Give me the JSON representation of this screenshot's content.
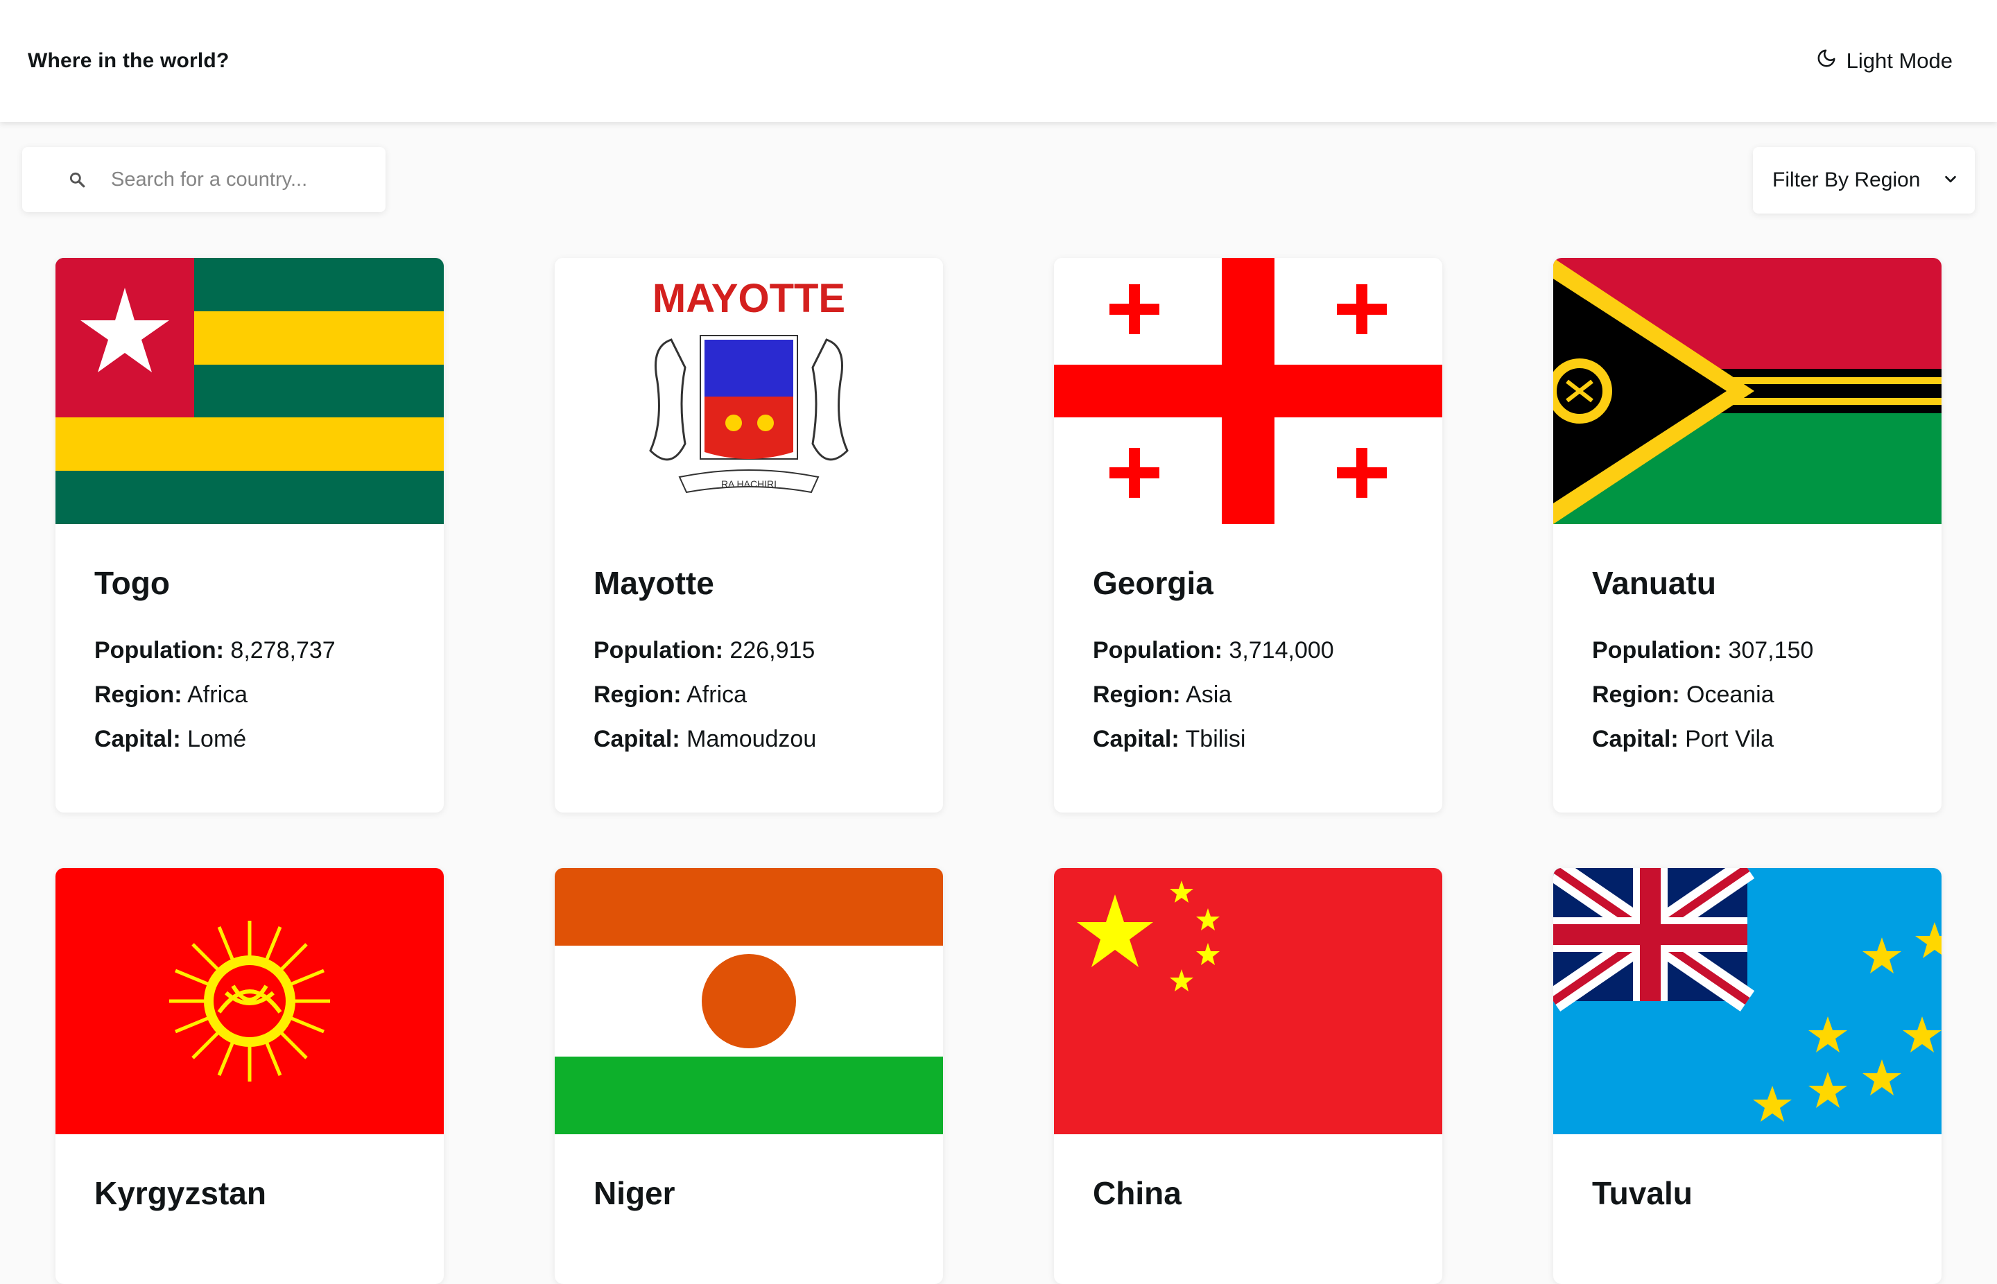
{
  "header": {
    "title": "Where in the world?",
    "mode_label": "Light Mode",
    "mode_icon": "moon-icon"
  },
  "search": {
    "placeholder": "Search for a country...",
    "icon": "search-icon"
  },
  "filter": {
    "label": "Filter By Region",
    "icon": "chevron-down-icon"
  },
  "labels": {
    "population": "Population:",
    "region": "Region:",
    "capital": "Capital:"
  },
  "flag_text": {
    "mayotte_banner": "MAYOTTE",
    "mayotte_ribbon": "RA HACHIRI"
  },
  "countries": [
    {
      "name": "Togo",
      "population": "8,278,737",
      "region": "Africa",
      "capital": "Lomé"
    },
    {
      "name": "Mayotte",
      "population": "226,915",
      "region": "Africa",
      "capital": "Mamoudzou"
    },
    {
      "name": "Georgia",
      "population": "3,714,000",
      "region": "Asia",
      "capital": "Tbilisi"
    },
    {
      "name": "Vanuatu",
      "population": "307,150",
      "region": "Oceania",
      "capital": "Port Vila"
    },
    {
      "name": "Kyrgyzstan"
    },
    {
      "name": "Niger"
    },
    {
      "name": "China"
    },
    {
      "name": "Tuvalu"
    }
  ],
  "colors": {
    "background": "#fafafa",
    "card": "#ffffff",
    "text": "#111517"
  }
}
